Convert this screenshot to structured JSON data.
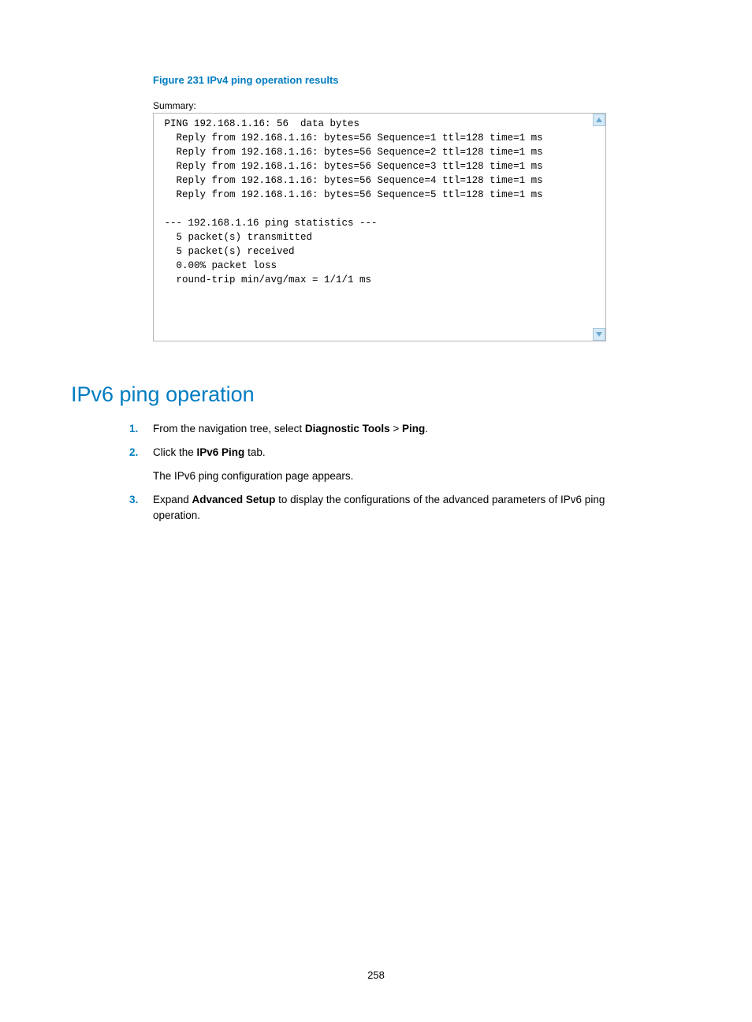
{
  "figure": {
    "caption": "Figure 231 IPv4 ping operation results"
  },
  "summary": {
    "label": "Summary:",
    "lines": [
      " PING 192.168.1.16: 56  data bytes",
      "   Reply from 192.168.1.16: bytes=56 Sequence=1 ttl=128 time=1 ms",
      "   Reply from 192.168.1.16: bytes=56 Sequence=2 ttl=128 time=1 ms",
      "   Reply from 192.168.1.16: bytes=56 Sequence=3 ttl=128 time=1 ms",
      "   Reply from 192.168.1.16: bytes=56 Sequence=4 ttl=128 time=1 ms",
      "   Reply from 192.168.1.16: bytes=56 Sequence=5 ttl=128 time=1 ms",
      "",
      " --- 192.168.1.16 ping statistics ---",
      "   5 packet(s) transmitted",
      "   5 packet(s) received",
      "   0.00% packet loss",
      "   round-trip min/avg/max = 1/1/1 ms"
    ]
  },
  "heading": "IPv6 ping operation",
  "steps": {
    "s1a": "From the navigation tree, select ",
    "s1b": "Diagnostic Tools",
    "s1c": " > ",
    "s1d": "Ping",
    "s1e": ".",
    "s2a": "Click the ",
    "s2b": "IPv6 Ping",
    "s2c": " tab.",
    "s2sub": "The IPv6 ping configuration page appears.",
    "s3a": "Expand ",
    "s3b": "Advanced Setup",
    "s3c": " to display the configurations of the advanced parameters of IPv6 ping operation."
  },
  "page_number": "258"
}
